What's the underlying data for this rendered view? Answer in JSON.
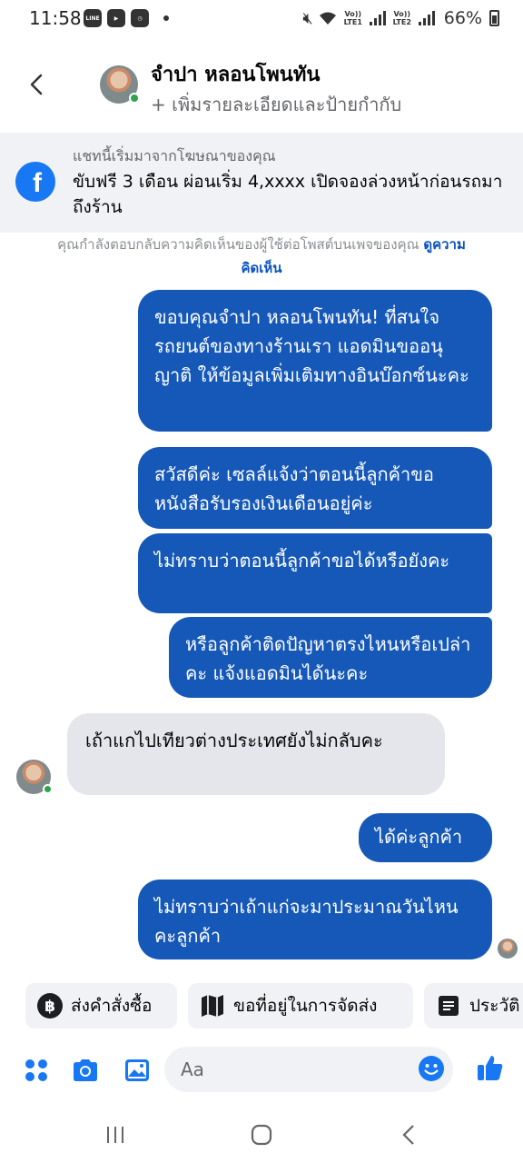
{
  "status_bar": {
    "time": "11:58",
    "battery": "66%",
    "sim1": "Vo)) LTE1",
    "sim2": "Vo)) LTE2"
  },
  "header": {
    "name": "จำปา หลอนโพนทัน",
    "subtitle": "+ เพิ่มรายละเอียดและป้ายกำกับ"
  },
  "ad_banner": {
    "label": "แชทนี้เริ่มมาจากโฆษณาของคุณ",
    "text": "ขับฟรี 3 เดือน ผ่อนเริ่ม 4,xxxx เปิดจองล่วงหน้าก่อนรถมาถึงร้าน"
  },
  "reply_notice": {
    "text": "คุณกำลังตอบกลับความคิดเห็นของผู้ใช้ต่อโพสต์บนเพจของคุณ",
    "link": "ดูความคิดเห็น"
  },
  "messages": [
    {
      "direction": "outgoing",
      "text": "ขอบคุณจำปา หลอนโพนทัน! ที่สนใจรถยนต์ของทางร้านเรา แอดมินขออนุญาติ ให้ข้อมูลเพิ่มเติมทางอินบ๊อกซ์นะคะ"
    },
    {
      "direction": "outgoing",
      "text": "สวัสดีค่ะ เซลล์แจ้งว่าตอนนี้ลูกค้าขอหนังสือรับรองเงินเดือนอยู่ค่ะ"
    },
    {
      "direction": "outgoing",
      "text": "ไม่ทราบว่าตอนนี้ลูกค้าขอได้หรือยังคะ"
    },
    {
      "direction": "outgoing",
      "text": "หรือลูกค้าติดปัญหาตรงไหนหรือเปล่าคะ แจ้งแอดมินได้นะคะ"
    },
    {
      "direction": "incoming",
      "text": "เถ้าแกไปเทียวต่างประเทศยังไม่กลับคะ"
    },
    {
      "direction": "outgoing",
      "text": "ได้ค่ะลูกค้า"
    },
    {
      "direction": "outgoing",
      "text": "ไม่ทราบว่าเถ้าแก่จะมาประมาณวันไหนคะลูกค้า"
    }
  ],
  "quick_actions": [
    {
      "label": "ส่งคำสั่งซื้อ",
      "icon": "baht-coin-icon"
    },
    {
      "label": "ขอที่อยู่ในการจัดส่ง",
      "icon": "map-icon"
    },
    {
      "label": "ประวัติ",
      "icon": "document-icon"
    }
  ],
  "composer": {
    "placeholder": "Aa"
  },
  "colors": {
    "outgoing_bubble": "#1558b8",
    "incoming_bubble": "#e4e6eb",
    "accent": "#1877f2"
  }
}
